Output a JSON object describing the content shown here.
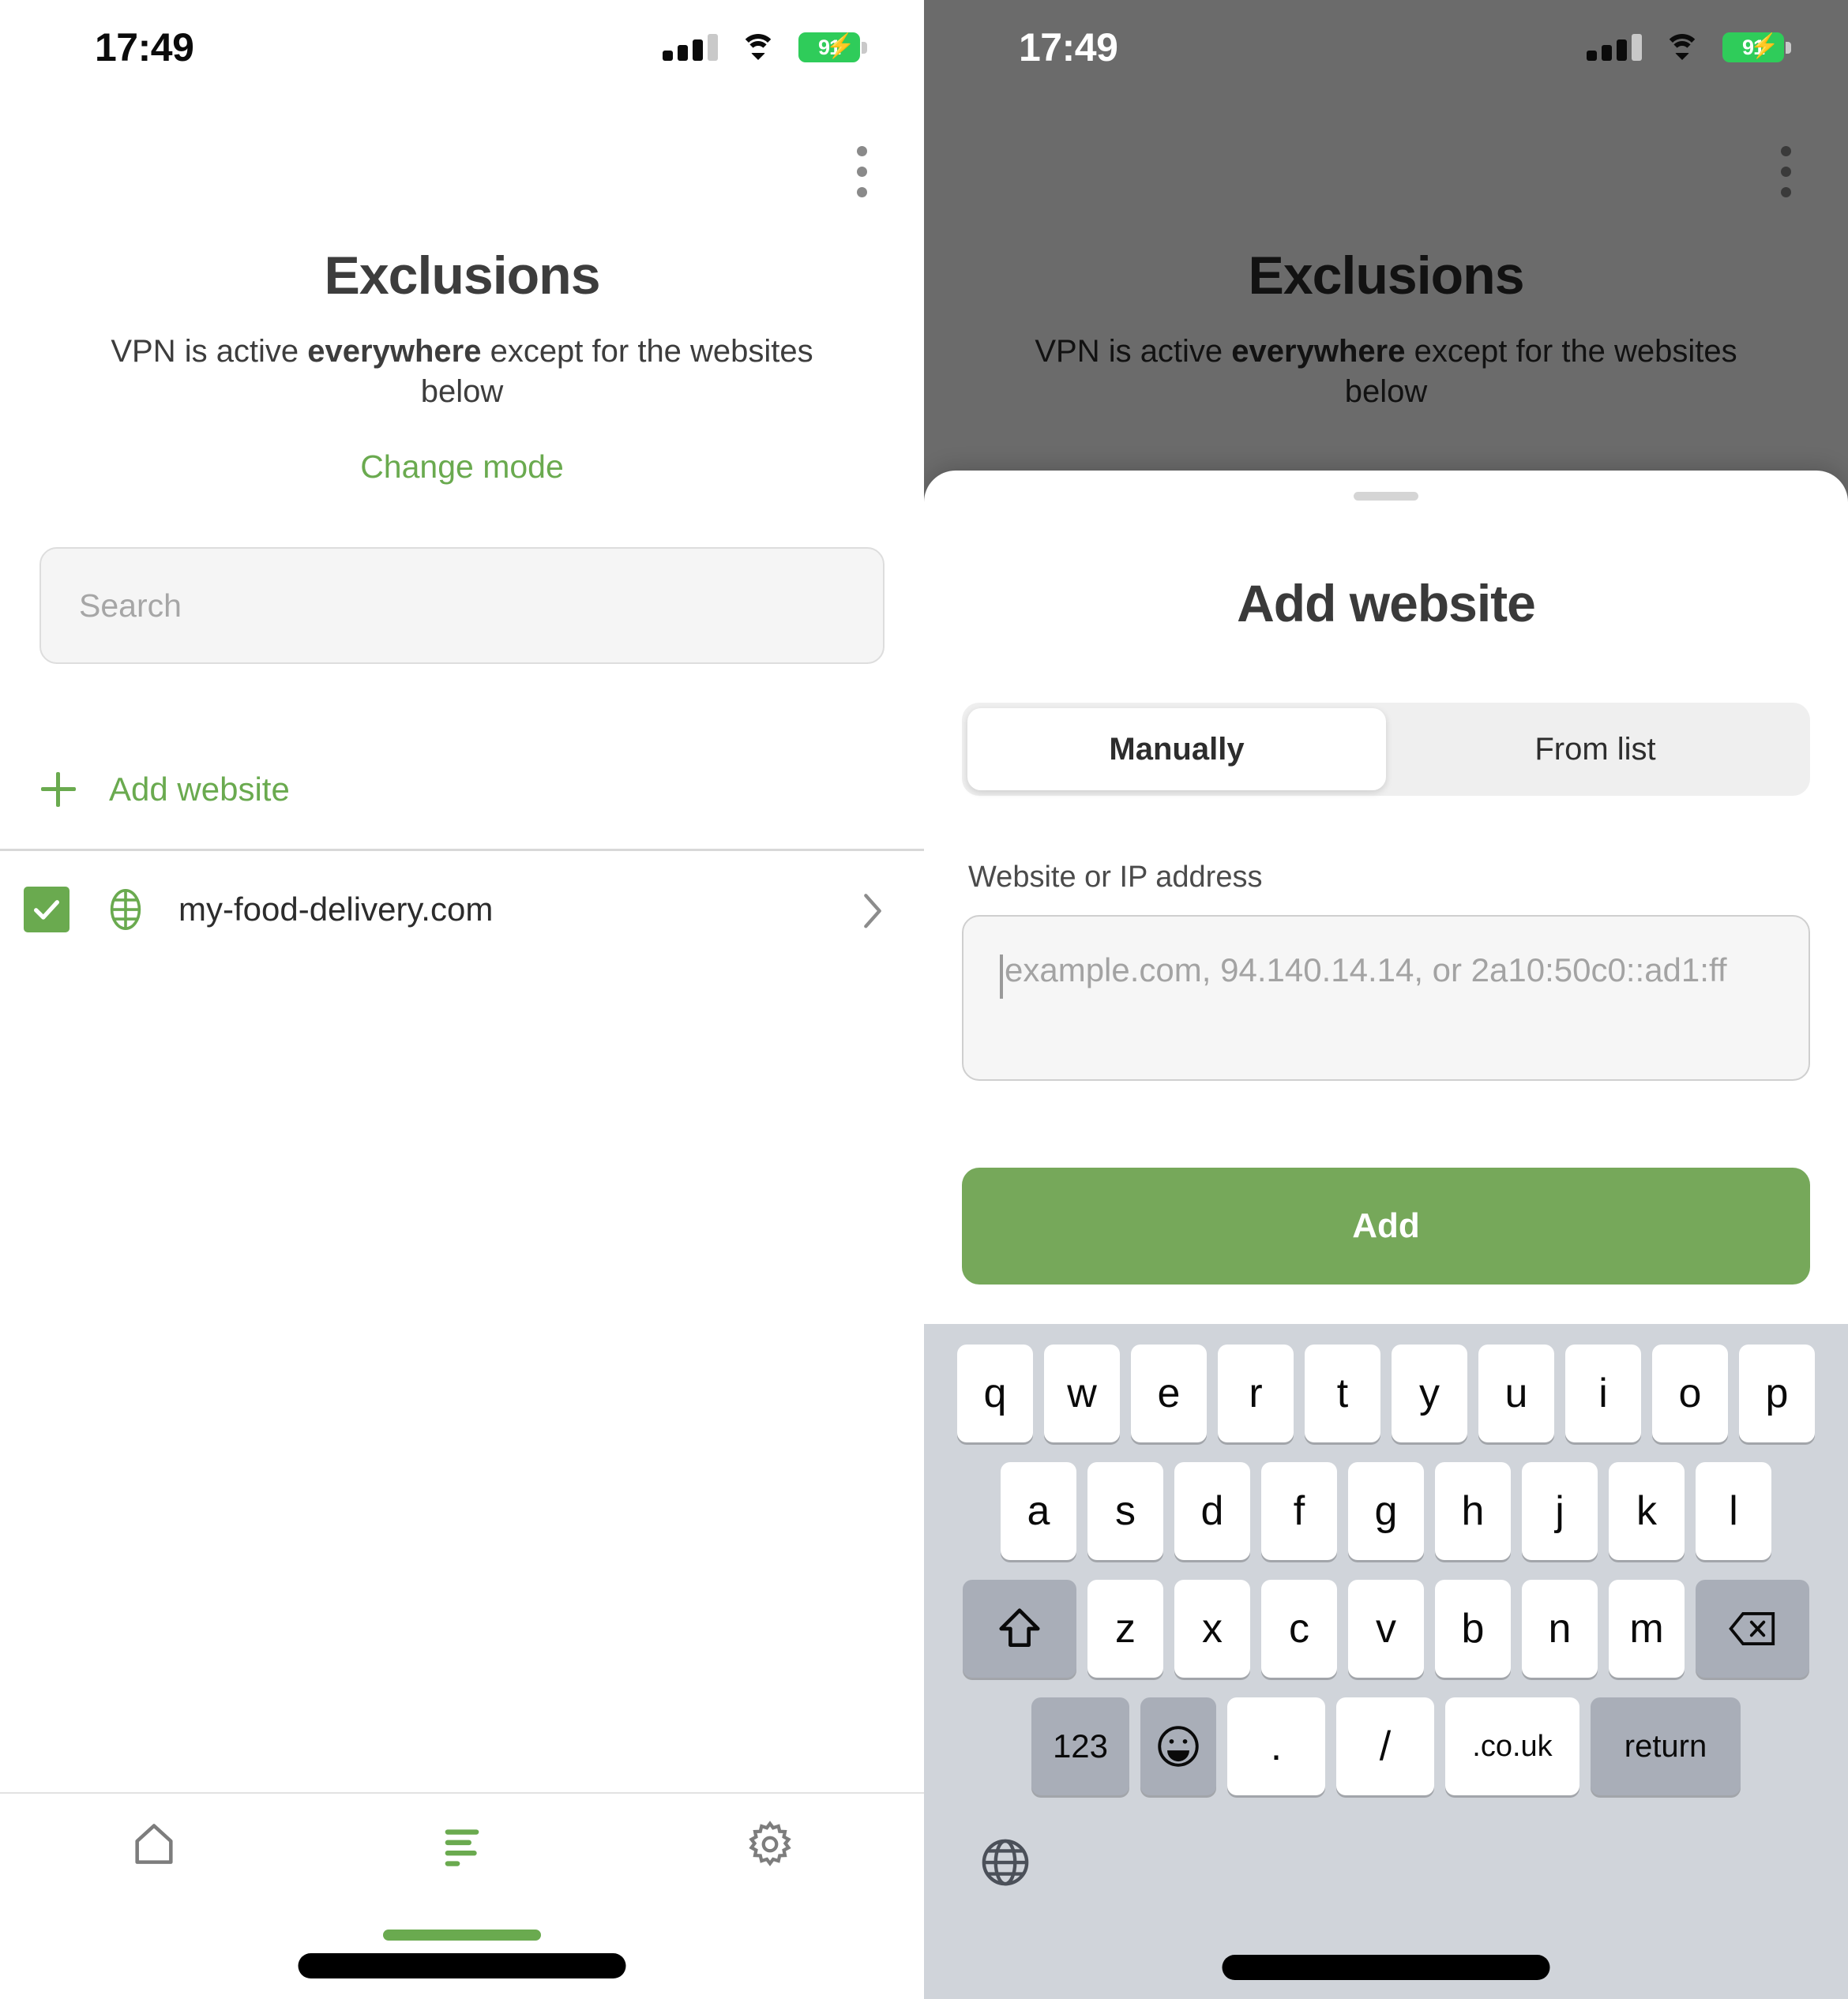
{
  "status_bar": {
    "time": "17:49",
    "battery_percent": "91",
    "signal_icon": "signal-bars-icon",
    "wifi_icon": "wifi-icon",
    "battery_icon": "battery-charging-icon"
  },
  "colors": {
    "accent_green": "#6aaa4f",
    "button_green": "#76a85a",
    "battery_green": "#2fcc5a",
    "dim_overlay": "#6b6b6b",
    "keyboard_bg": "#d0d4da",
    "key_grey": "#a9aeb8"
  },
  "exclusions_screen": {
    "menu_icon": "kebab-menu-icon",
    "title": "Exclusions",
    "subtitle_prefix": "VPN is active ",
    "subtitle_bold": "everywhere",
    "subtitle_suffix": " except for the websites below",
    "change_mode_label": "Change mode",
    "search_placeholder": "Search",
    "add_website_label": "Add website",
    "websites": [
      {
        "name": "my-food-delivery.com",
        "checked": true,
        "icon": "globe-icon",
        "chevron": "chevron-right-icon"
      }
    ],
    "tabs": [
      {
        "name": "home",
        "icon": "home-icon",
        "active": false
      },
      {
        "name": "exclusions",
        "icon": "exclusions-lines-icon",
        "active": true
      },
      {
        "name": "settings",
        "icon": "gear-icon",
        "active": false
      }
    ]
  },
  "add_website_sheet": {
    "handle": "drag-handle",
    "title": "Add website",
    "segments": [
      {
        "label": "Manually",
        "active": true
      },
      {
        "label": "From list",
        "active": false
      }
    ],
    "field_label": "Website or IP address",
    "field_value": "",
    "field_placeholder": "example.com, 94.140.14.14, or 2a10:50c0::ad1:ff",
    "submit_label": "Add"
  },
  "keyboard": {
    "row1": [
      "q",
      "w",
      "e",
      "r",
      "t",
      "y",
      "u",
      "i",
      "o",
      "p"
    ],
    "row2": [
      "a",
      "s",
      "d",
      "f",
      "g",
      "h",
      "j",
      "k",
      "l"
    ],
    "row3": [
      "z",
      "x",
      "c",
      "v",
      "b",
      "n",
      "m"
    ],
    "shift_icon": "shift-arrow-icon",
    "backspace_icon": "backspace-icon",
    "numbers_label": "123",
    "emoji_icon": "emoji-smiley-icon",
    "period_label": ".",
    "slash_label": "/",
    "tld_label": ".co.uk",
    "return_label": "return",
    "globe_icon": "globe-language-icon"
  }
}
